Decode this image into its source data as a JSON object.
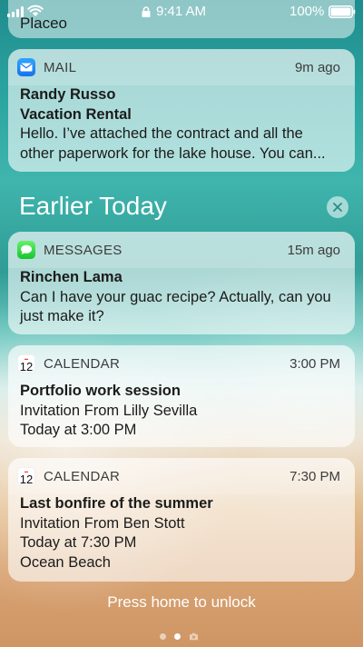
{
  "status_bar": {
    "time": "9:41 AM",
    "battery_percent": "100%",
    "signal_bars": 4,
    "battery_level": 1.0
  },
  "partial_card": {
    "text": "Placeo"
  },
  "mail": {
    "app_name": "MAIL",
    "time": "9m ago",
    "sender": "Randy Russo",
    "subject": "Vacation Rental",
    "preview_line1": "Hello. I’ve attached the contract and all the",
    "preview_line2": "other paperwork for the lake house. You can...",
    "icon": "mail-icon"
  },
  "section": {
    "title": "Earlier Today",
    "clear_icon": "close-icon"
  },
  "messages": {
    "app_name": "MESSAGES",
    "time": "15m ago",
    "sender": "Rinchen Lama",
    "line1": "Can I have your guac recipe? Actually, can you",
    "line2": "just make it?",
    "icon": "messages-icon"
  },
  "calendar1": {
    "app_name": "CALENDAR",
    "time": "3:00 PM",
    "icon_day": "12",
    "title": "Portfolio work session",
    "invite": "Invitation From Lilly Sevilla",
    "when": "Today at 3:00 PM"
  },
  "calendar2": {
    "app_name": "CALENDAR",
    "time": "7:30 PM",
    "icon_day": "12",
    "title": "Last bonfire of the summer",
    "invite": "Invitation From Ben Stott",
    "when": "Today at 7:30 PM",
    "location": "Ocean Beach"
  },
  "footer": {
    "unlock_text": "Press home to unlock",
    "page_count": 2,
    "active_page": 2
  },
  "colors": {
    "mail_blue": "#1572ee",
    "messages_green": "#17c42d",
    "calendar_red": "#ff3b30"
  }
}
